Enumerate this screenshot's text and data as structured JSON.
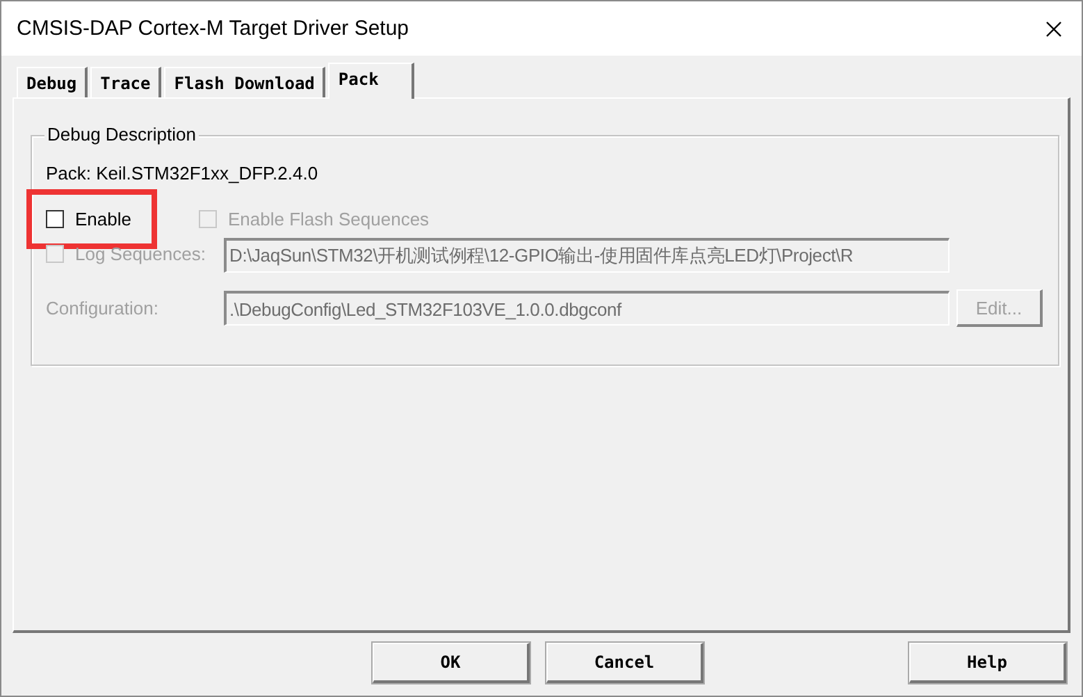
{
  "window": {
    "title": "CMSIS-DAP Cortex-M Target Driver Setup"
  },
  "tabs": [
    {
      "label": "Debug",
      "selected": false
    },
    {
      "label": "Trace",
      "selected": false
    },
    {
      "label": "Flash Download",
      "selected": false
    },
    {
      "label": "Pack",
      "selected": true
    }
  ],
  "debug_description": {
    "title": "Debug Description",
    "pack": "Pack: Keil.STM32F1xx_DFP.2.4.0",
    "enable": {
      "label": "Enable",
      "checked": false,
      "disabled": false,
      "highlighted": true
    },
    "enable_flash_sequences": {
      "label": "Enable Flash Sequences",
      "checked": false,
      "disabled": true
    },
    "log_sequences": {
      "label": "Log Sequences:",
      "checked": false,
      "disabled": true,
      "value": "D:\\JaqSun\\STM32\\开机测试例程\\12-GPIO输出-使用固件库点亮LED灯\\Project\\R"
    },
    "configuration": {
      "label": "Configuration:",
      "disabled": true,
      "value": ".\\DebugConfig\\Led_STM32F103VE_1.0.0.dbgconf",
      "edit_button": "Edit..."
    }
  },
  "buttons": [
    {
      "label": "OK"
    },
    {
      "label": "Cancel"
    },
    {
      "label": "Help"
    }
  ]
}
